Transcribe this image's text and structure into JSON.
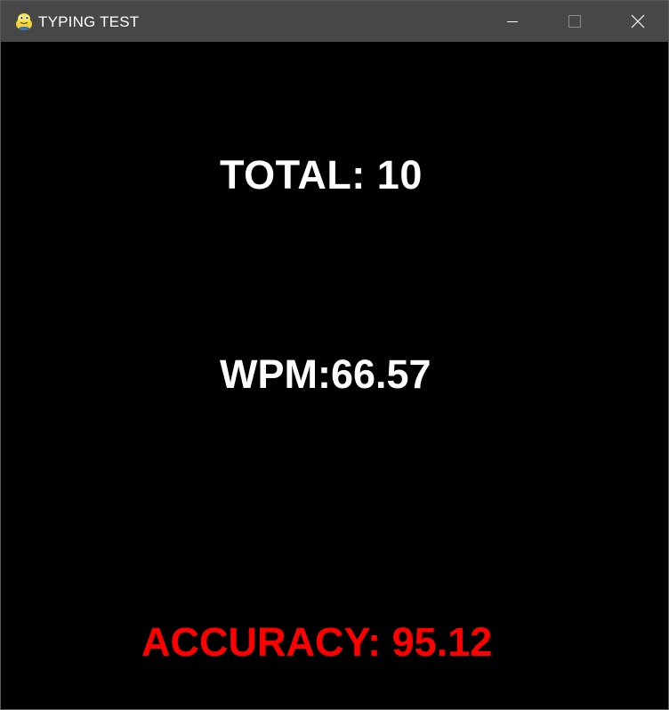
{
  "window": {
    "title": "TYPING TEST",
    "app_icon": "pygame-snake-icon",
    "controls": [
      "minimize-icon",
      "maximize-icon",
      "close-icon"
    ]
  },
  "results": {
    "total_text": "TOTAL: 10",
    "wpm_text": "WPM:66.57",
    "accuracy_text": "ACCURACY: 95.12"
  },
  "colors": {
    "titlebar": "#474747",
    "background": "#000000",
    "primary_text": "#ffffff",
    "accuracy_text": "#ff0000"
  }
}
